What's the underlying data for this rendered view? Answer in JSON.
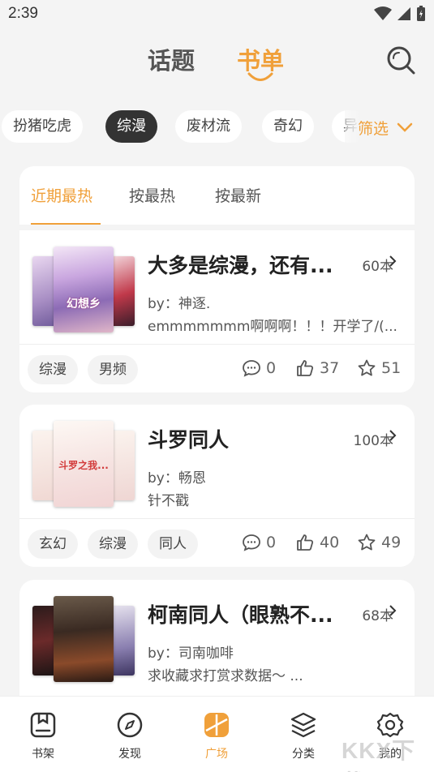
{
  "status": {
    "time": "2:39"
  },
  "header": {
    "tabs": [
      "话题",
      "书单"
    ],
    "active_tab": "书单"
  },
  "tags": [
    "扮猪吃虎",
    "综漫",
    "废材流",
    "奇幻",
    "异"
  ],
  "active_tag": "综漫",
  "filter_label": "筛选",
  "sort": {
    "options": [
      "近期最热",
      "按最热",
      "按最新"
    ],
    "active": "近期最热"
  },
  "booklists": [
    {
      "title": "大多是综漫，还有...",
      "count": "60本",
      "by": "by：神逐.",
      "desc": "emmmmmmm啊啊啊！！！开学了/(...",
      "tags": [
        "综漫",
        "男频"
      ],
      "comments": "0",
      "likes": "37",
      "stars": "51",
      "cover_text": "幻想乡"
    },
    {
      "title": "斗罗同人",
      "count": "100本",
      "by": "by：畅恩",
      "desc": "针不戳",
      "tags": [
        "玄幻",
        "综漫",
        "同人"
      ],
      "comments": "0",
      "likes": "40",
      "stars": "49",
      "cover_text": "斗罗之我..."
    },
    {
      "title": "柯南同人（眼熟不...",
      "count": "68本",
      "by": "by：司南咖啡",
      "desc": "求收藏求打赏求数据～ ...",
      "tags": [],
      "comments": "",
      "likes": "",
      "stars": "",
      "cover_text": ""
    }
  ],
  "bottom_nav": [
    "书架",
    "发现",
    "广场",
    "分类",
    "我的"
  ],
  "bottom_nav_active": "广场",
  "watermark": "KKX下载",
  "colors": {
    "accent": "#f0a03a",
    "dark": "#333333",
    "bg": "#f4f4f4"
  }
}
